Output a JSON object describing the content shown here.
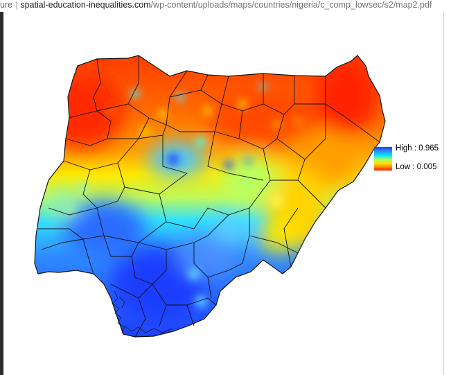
{
  "browser": {
    "url_prefix": "ure",
    "url_host": "spatial-education-inequalities.com",
    "url_path": "/wp-content/uploads/maps/countries/nigeria/c_comp_lowsec/s2/map2.pdf"
  },
  "map": {
    "legend_high": "High : 0.965",
    "legend_low": "Low : 0.005"
  },
  "colors": {
    "high": "#1f3cff",
    "mid": "#00e5ff",
    "low": "#ff1e00",
    "yellow": "#ffe000",
    "orange": "#ff8a00"
  }
}
